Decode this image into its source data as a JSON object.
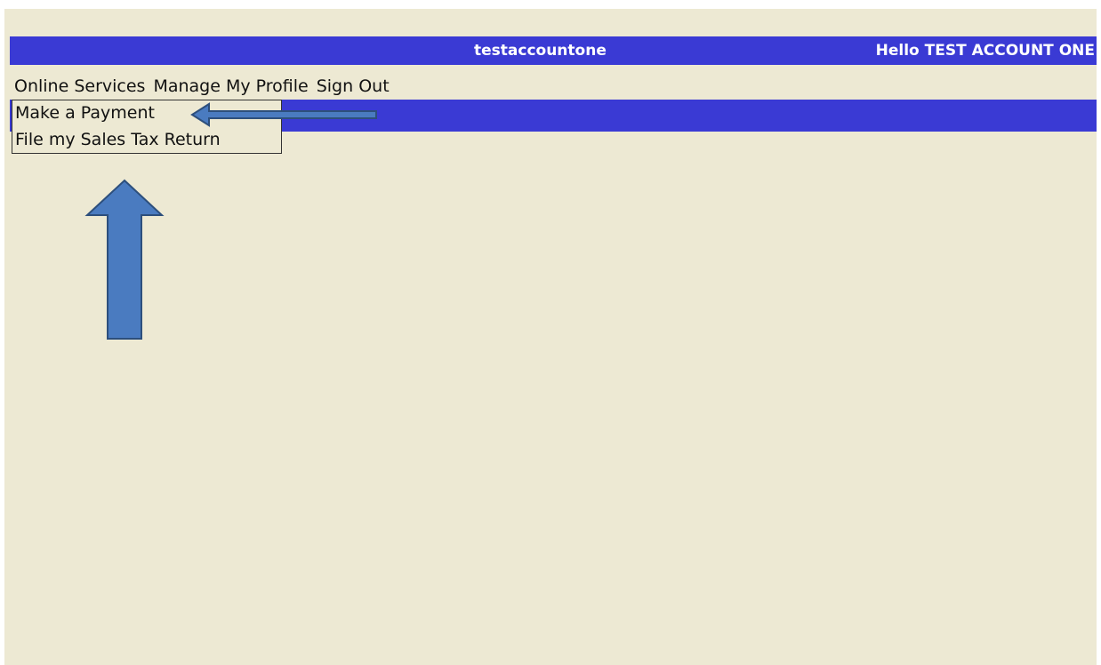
{
  "header": {
    "account_name": "testaccountone",
    "greeting": "Hello TEST ACCOUNT ONE"
  },
  "menu": {
    "items": [
      {
        "label": "Online Services"
      },
      {
        "label": "Manage My Profile"
      },
      {
        "label": "Sign Out"
      }
    ]
  },
  "dropdown": {
    "items": [
      {
        "label": "Make a Payment"
      },
      {
        "label": "File my Sales Tax Return"
      }
    ]
  },
  "colors": {
    "page_background": "#ede9d3",
    "header_bar": "#3a3ad4",
    "annotation_arrow_fill": "#4a7bc0",
    "annotation_arrow_stroke": "#2d4f7c"
  }
}
